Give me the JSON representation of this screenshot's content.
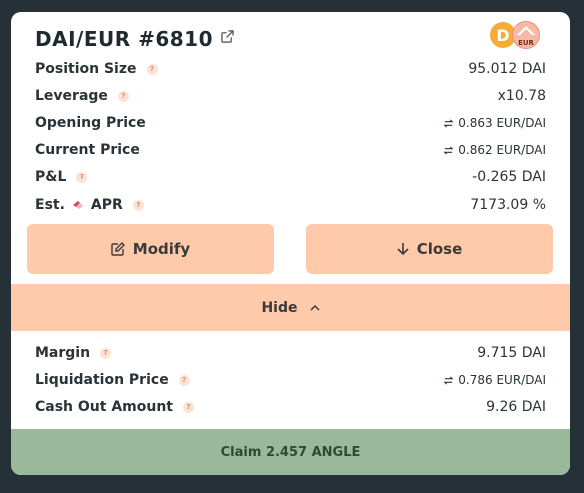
{
  "position": {
    "title": "DAI/EUR #6810",
    "token_base": "D",
    "token_quote": "EUR"
  },
  "rows": {
    "position_size": {
      "label": "Position Size",
      "value": "95.012 DAI"
    },
    "leverage": {
      "label": "Leverage",
      "value": "x10.78"
    },
    "opening_price": {
      "label": "Opening Price",
      "value": "0.863 EUR/DAI"
    },
    "current_price": {
      "label": "Current Price",
      "value": "0.862 EUR/DAI"
    },
    "pnl": {
      "label": "P&L",
      "value": "-0.265 DAI"
    },
    "apr": {
      "label_prefix": "Est.",
      "label": "APR",
      "value": "7173.09 %"
    }
  },
  "actions": {
    "modify_label": "Modify",
    "close_label": "Close",
    "hide_label": "Hide",
    "claim_label": "Claim 2.457 ANGLE"
  },
  "details": {
    "margin": {
      "label": "Margin",
      "value": "9.715 DAI"
    },
    "liquidation_price": {
      "label": "Liquidation Price",
      "value": "0.786 EUR/DAI"
    },
    "cash_out": {
      "label": "Cash Out Amount",
      "value": "9.26 DAI"
    }
  },
  "help_glyph": "?",
  "colors": {
    "background": "#253037",
    "card": "#ffffff",
    "accent": "#ffcaaa",
    "claim": "#9ab99b"
  },
  "icons": [
    "external-link-icon",
    "swap-icon",
    "edit-icon",
    "arrow-down-icon",
    "chevron-up-icon",
    "help-icon"
  ]
}
